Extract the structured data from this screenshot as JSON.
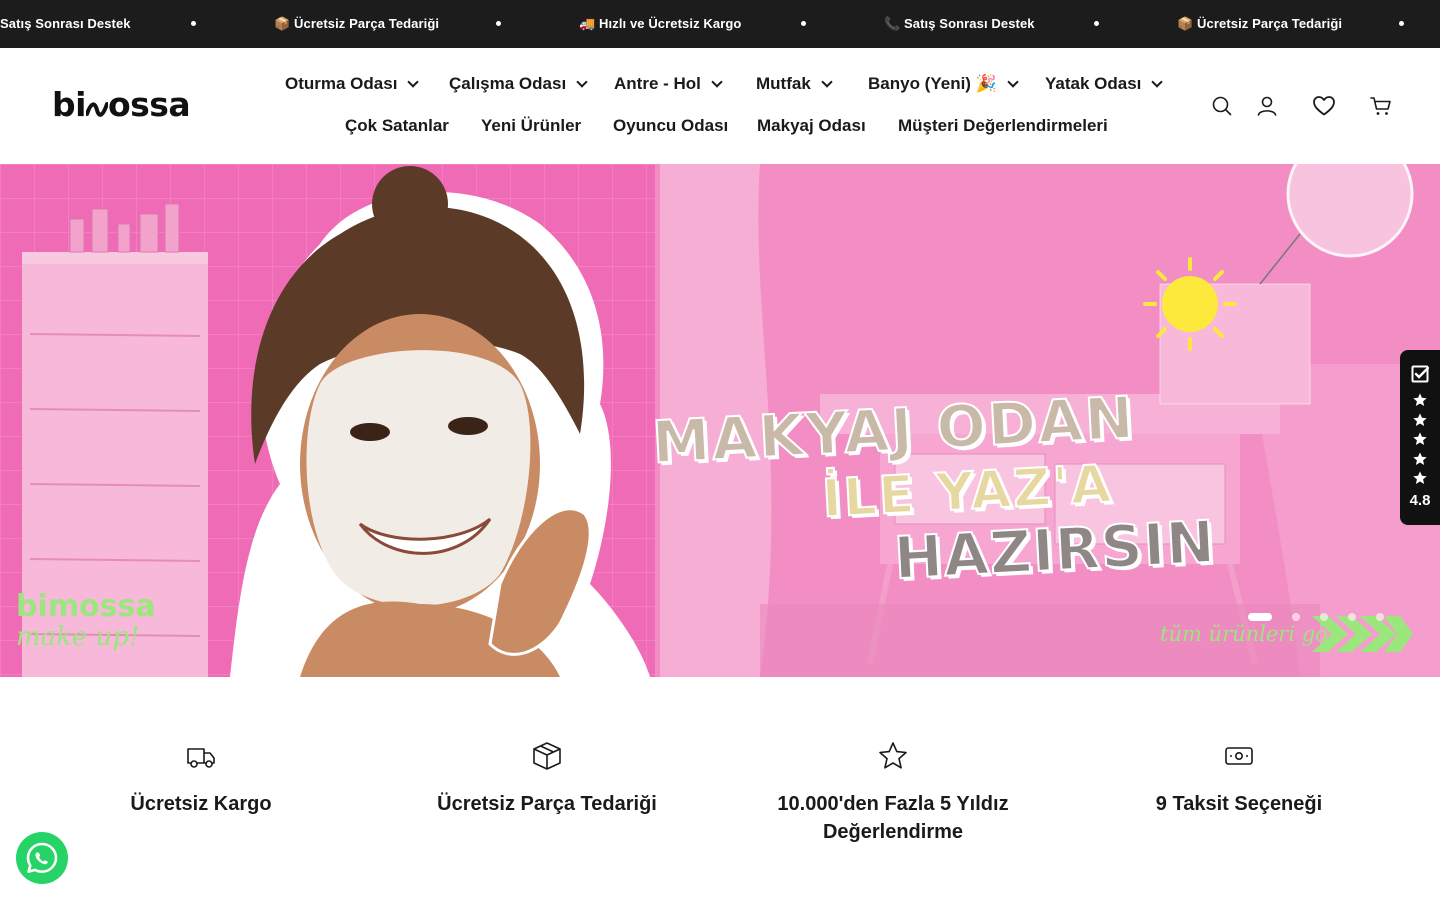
{
  "announcement": {
    "items": [
      {
        "icon": "none",
        "text": "Satış Sonrası Destek"
      },
      {
        "icon": "📦",
        "text": "Ücretsiz Parça Tedariği"
      },
      {
        "icon": "🚚",
        "text": "Hızlı ve Ücretsiz Kargo"
      },
      {
        "icon": "📞",
        "text": "Satış Sonrası Destek"
      },
      {
        "icon": "📦",
        "text": "Ücretsiz Parça Tedariği"
      }
    ]
  },
  "header": {
    "logo_text_a": "bi",
    "logo_text_b": "ossa",
    "nav_primary": [
      {
        "label": "Oturma Odası",
        "has_dropdown": true
      },
      {
        "label": "Çalışma Odası",
        "has_dropdown": true
      },
      {
        "label": "Antre - Hol",
        "has_dropdown": true
      },
      {
        "label": "Mutfak",
        "has_dropdown": true
      },
      {
        "label": "Banyo (Yeni) 🎉",
        "has_dropdown": true
      },
      {
        "label": "Yatak Odası",
        "has_dropdown": true
      }
    ],
    "nav_secondary": [
      {
        "label": "Çok Satanlar"
      },
      {
        "label": "Yeni Ürünler"
      },
      {
        "label": "Oyuncu Odası"
      },
      {
        "label": "Makyaj Odası"
      },
      {
        "label": "Müşteri Değerlendirmeleri"
      }
    ],
    "icons": [
      "search-icon",
      "account-icon",
      "wishlist-heart-icon",
      "cart-icon"
    ]
  },
  "hero": {
    "headline_1": "MAKYAJ ODAN",
    "headline_2": "İLE YAZ'A",
    "headline_3": "HAZIRSIN",
    "brand_a": "bimossa",
    "brand_b": "make up!",
    "cta": "tüm ürünleri gör",
    "slides_total": 6,
    "active_slide": 1,
    "colors": {
      "background": "#f06bb6",
      "accent_green": "#9be67d"
    }
  },
  "reviews_badge": {
    "score": "4.8",
    "stars": 5
  },
  "features": [
    {
      "icon": "truck-icon",
      "label": "Ücretsiz Kargo"
    },
    {
      "icon": "box-icon",
      "label": "Ücretsiz Parça Tedariği"
    },
    {
      "icon": "star-icon",
      "label": "10.000'den Fazla 5 Yıldız Değerlendirme"
    },
    {
      "icon": "money-icon",
      "label": "9 Taksit Seçeneği"
    }
  ],
  "whatsapp": {
    "icon": "whatsapp-icon",
    "color": "#25d366"
  }
}
